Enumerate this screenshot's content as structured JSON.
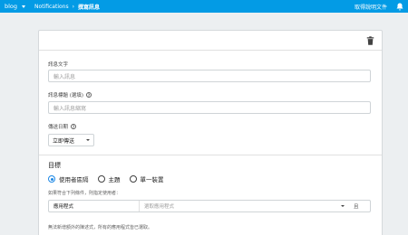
{
  "topbar": {
    "project": "blog",
    "crumb_parent": "Notifications",
    "crumb_separator": "›",
    "crumb_current": "撰寫訊息",
    "docs_link": "取得說明文件",
    "bell_icon": "bell-icon",
    "bg_color": "#039be5"
  },
  "card": {
    "delete_icon": "trash-icon",
    "message_text": {
      "label": "訊息文字",
      "placeholder": "輸入訊息"
    },
    "message_title": {
      "label": "訊息標題 (選填)",
      "help": "?",
      "placeholder": "輸入訊息縮寫"
    },
    "delivery_date": {
      "label": "傳送日期",
      "help": "?",
      "value": "立即傳送"
    },
    "target": {
      "title": "目標",
      "options": [
        "使用者區隔",
        "主題",
        "單一裝置"
      ],
      "selected_index": 0,
      "hint": "如果符合下列條件，則指定使用者：",
      "condition_key": "應用程式",
      "condition_placeholder": "選取應用程式",
      "condition_and": "且",
      "note": "無法新增額外的陳述式，所有的應用程式皆已選取。"
    },
    "accent_color": "#1e88e5"
  }
}
